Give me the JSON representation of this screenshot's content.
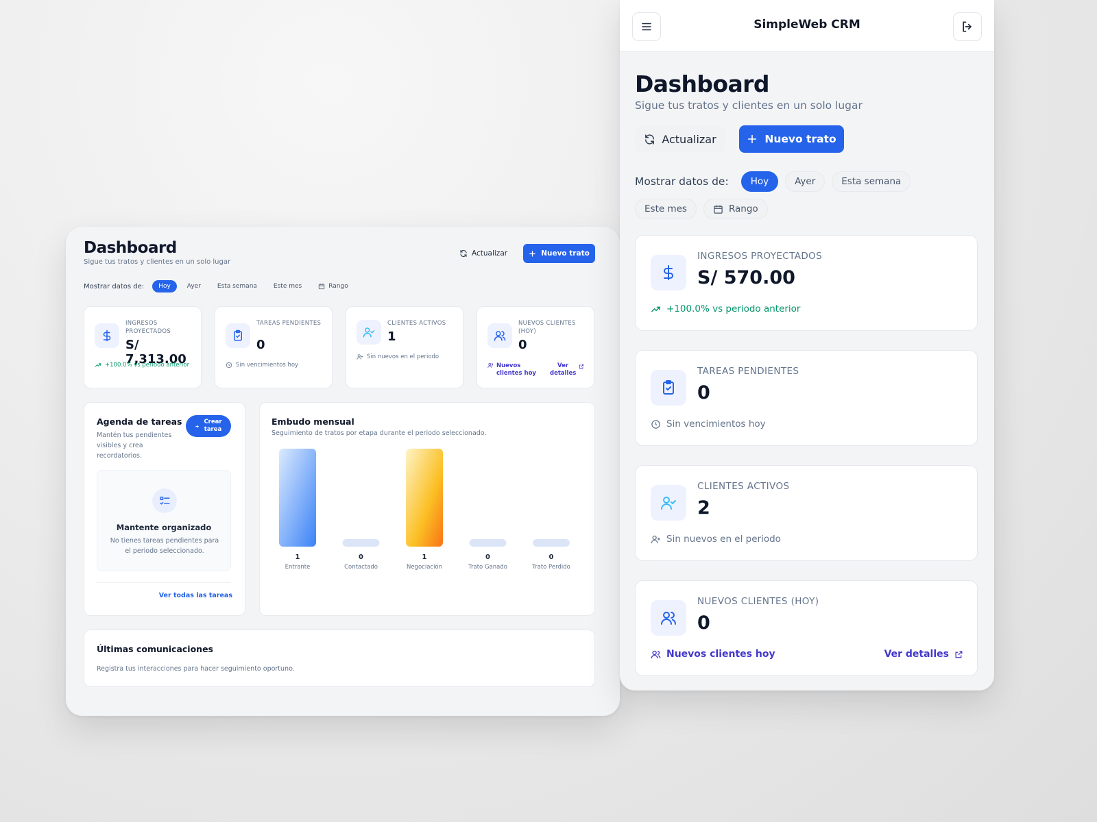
{
  "colors": {
    "accent": "#2563eb",
    "success": "#059669",
    "link": "#4338ca",
    "muted": "#64748b"
  },
  "desktop": {
    "title": "Dashboard",
    "subtitle": "Sigue tus tratos y clientes en un solo lugar",
    "refresh_label": "Actualizar",
    "new_deal_label": "Nuevo trato",
    "filters": {
      "label": "Mostrar datos de:",
      "options": [
        "Hoy",
        "Ayer",
        "Esta semana",
        "Este mes",
        "Rango"
      ],
      "active": "Hoy"
    },
    "kpis": [
      {
        "caption": "Ingresos proyectados",
        "value": "S/ 7,313.00",
        "note": "+100.0% vs periodo anterior",
        "icon": "dollar-icon"
      },
      {
        "caption": "Tareas pendientes",
        "value": "0",
        "note": "Sin vencimientos hoy",
        "icon": "clipboard-check-icon"
      },
      {
        "caption": "Clientes activos",
        "value": "1",
        "note": "Sin nuevos en el periodo",
        "icon": "user-check-icon"
      },
      {
        "caption": "Nuevos clientes (hoy)",
        "value": "0",
        "link_left": "Nuevos clientes hoy",
        "link_right": "Ver detalles",
        "icon": "users-icon"
      }
    ],
    "agenda": {
      "title": "Agenda de tareas",
      "subtitle": "Mantén tus pendientes visibles y crea recordatorios.",
      "create_label": "Crear tarea",
      "empty_title": "Mantente organizado",
      "empty_text": "No tienes tareas pendientes para el periodo seleccionado.",
      "view_all": "Ver todas las tareas"
    },
    "funnel": {
      "title": "Embudo mensual",
      "subtitle": "Seguimiento de tratos por etapa durante el periodo seleccionado."
    },
    "comms": {
      "title": "Últimas comunicaciones",
      "subtitle": "Registra tus interacciones para hacer seguimiento oportuno."
    }
  },
  "chart_data": {
    "type": "bar",
    "categories": [
      "Entrante",
      "Contactado",
      "Negociación",
      "Trato Ganado",
      "Trato Perdido"
    ],
    "values": [
      1,
      0,
      1,
      0,
      0
    ],
    "colors": [
      "#60a5fa",
      "#bfdbfe",
      "#fb923c",
      "#bfdbfe",
      "#bfdbfe"
    ]
  },
  "mobile": {
    "app_title": "SimpleWeb CRM",
    "title": "Dashboard",
    "subtitle": "Sigue tus tratos y clientes en un solo lugar",
    "refresh_label": "Actualizar",
    "new_deal_label": "Nuevo trato",
    "filters": {
      "label": "Mostrar datos de:",
      "options": [
        "Hoy",
        "Ayer",
        "Esta semana",
        "Este mes",
        "Rango"
      ],
      "active": "Hoy"
    },
    "kpis": [
      {
        "caption": "Ingresos proyectados",
        "value": "S/ 570.00",
        "note": "+100.0% vs periodo anterior",
        "icon": "dollar-icon"
      },
      {
        "caption": "Tareas pendientes",
        "value": "0",
        "note": "Sin vencimientos hoy",
        "icon": "clipboard-check-icon"
      },
      {
        "caption": "Clientes activos",
        "value": "2",
        "note": "Sin nuevos en el periodo",
        "icon": "user-check-icon"
      },
      {
        "caption": "Nuevos clientes (hoy)",
        "value": "0",
        "link_left": "Nuevos clientes hoy",
        "link_right": "Ver detalles",
        "icon": "users-icon"
      }
    ]
  }
}
